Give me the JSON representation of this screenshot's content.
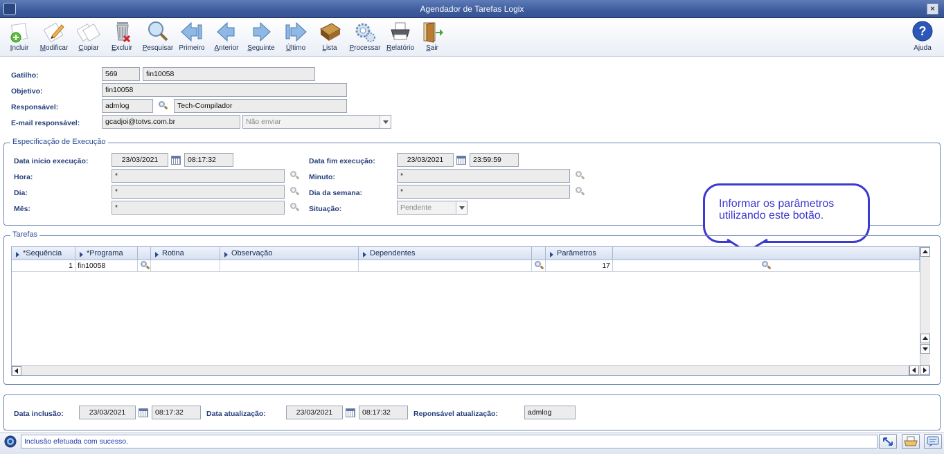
{
  "window": {
    "title": "Agendador de Tarefas Logix",
    "close_label": "×"
  },
  "toolbar": {
    "incluir": "Incluir",
    "modificar": "Modificar",
    "copiar": "Copiar",
    "excluir": "Excluir",
    "pesquisar": "Pesquisar",
    "primeiro": "Primeiro",
    "anterior": "Anterior",
    "seguinte": "Seguinte",
    "ultimo": "Último",
    "lista": "Lista",
    "processar": "Processar",
    "relatorio": "Relatório",
    "sair": "Sair",
    "ajuda": "Ajuda"
  },
  "header": {
    "gatilho_label": "Gatilho:",
    "gatilho_code": "569",
    "gatilho_name": "fin10058",
    "objetivo_label": "Objetivo:",
    "objetivo_value": "fin10058",
    "responsavel_label": "Responsável:",
    "responsavel_user": "admlog",
    "responsavel_name": "Tech-Compilador",
    "email_label": "E-mail responsável:",
    "email_value": "gcadjoi@totvs.com.br",
    "email_option": "Não enviar"
  },
  "execucao": {
    "legend": "Especificação de Execução",
    "inicio_label": "Data início execução:",
    "inicio_date": "23/03/2021",
    "inicio_time": "08:17:32",
    "fim_label": "Data fim execução:",
    "fim_date": "23/03/2021",
    "fim_time": "23:59:59",
    "hora_label": "Hora:",
    "hora_value": "*",
    "minuto_label": "Minuto:",
    "minuto_value": "*",
    "dia_label": "Dia:",
    "dia_value": "*",
    "dia_semana_label": "Dia da semana:",
    "dia_semana_value": "*",
    "mes_label": "Mês:",
    "mes_value": "*",
    "situacao_label": "Situação:",
    "situacao_value": "Pendente"
  },
  "callout": {
    "line1": "Informar os parâmetros",
    "line2": "utilizando este botão."
  },
  "tarefas": {
    "legend": "Tarefas",
    "columns": [
      "*Sequência",
      "*Programa",
      "Rotina",
      "Observação",
      "Dependentes",
      "Parâmetros"
    ],
    "rows": [
      {
        "sequencia": "1",
        "programa": "fin10058",
        "rotina": "",
        "observacao": "",
        "dependentes": "",
        "parametros": "17"
      }
    ]
  },
  "footer": {
    "inclusao_label": "Data inclusão:",
    "inclusao_date": "23/03/2021",
    "inclusao_time": "08:17:32",
    "atualizacao_label": "Data atualização:",
    "atualizacao_date": "23/03/2021",
    "atualizacao_time": "08:17:32",
    "resp_label": "Reponsável atualização:",
    "resp_value": "admlog"
  },
  "status": {
    "message": "Inclusão efetuada com sucesso."
  }
}
